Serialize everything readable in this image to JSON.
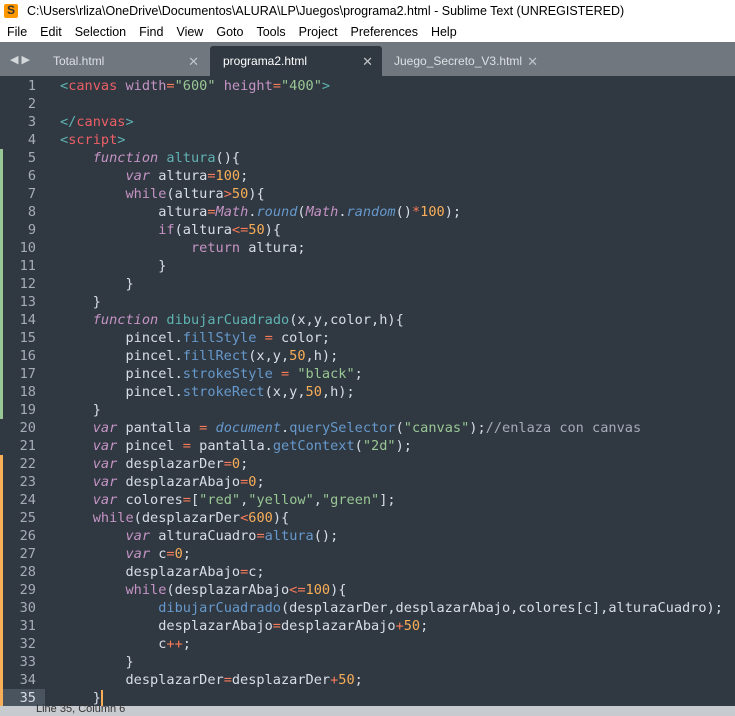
{
  "window": {
    "title": "C:\\Users\\rliza\\OneDrive\\Documentos\\ALURA\\LP\\Juegos\\programa2.html - Sublime Text (UNREGISTERED)"
  },
  "menu": [
    "File",
    "Edit",
    "Selection",
    "Find",
    "View",
    "Goto",
    "Tools",
    "Project",
    "Preferences",
    "Help"
  ],
  "tabs": [
    {
      "label": "Total.html",
      "active": false
    },
    {
      "label": "programa2.html",
      "active": true
    },
    {
      "label": "Juego_Secreto_V3.html",
      "active": false
    }
  ],
  "status": {
    "text": "Line 35, Column 6"
  },
  "colors": {
    "background": "#303841",
    "added": "#99c794",
    "modified": "#f9ae58"
  },
  "current_line": 35,
  "gutter_marks": {
    "added": [
      5,
      19
    ],
    "modified": [
      22,
      35
    ]
  },
  "code": [
    [
      [
        "p",
        "<"
      ],
      [
        "t",
        "canvas"
      ],
      [
        "a",
        " width"
      ],
      [
        "o",
        "="
      ],
      [
        "s",
        "\"600\""
      ],
      [
        "a",
        " height"
      ],
      [
        "o",
        "="
      ],
      [
        "s",
        "\"400\""
      ],
      [
        "p",
        ">"
      ]
    ],
    [],
    [
      [
        "p",
        "</"
      ],
      [
        "t",
        "canvas"
      ],
      [
        "p",
        ">"
      ]
    ],
    [
      [
        "p",
        "<"
      ],
      [
        "t",
        "script"
      ],
      [
        "p",
        ">"
      ]
    ],
    [
      [
        "x",
        "    "
      ],
      [
        "k",
        "function"
      ],
      [
        "x",
        " "
      ],
      [
        "f",
        "altura"
      ],
      [
        "x",
        "(){"
      ]
    ],
    [
      [
        "x",
        "        "
      ],
      [
        "k",
        "var"
      ],
      [
        "x",
        " altura"
      ],
      [
        "o",
        "="
      ],
      [
        "n",
        "100"
      ],
      [
        "x",
        ";"
      ]
    ],
    [
      [
        "x",
        "        "
      ],
      [
        "c",
        "while"
      ],
      [
        "x",
        "(altura"
      ],
      [
        "o",
        ">"
      ],
      [
        "n",
        "50"
      ],
      [
        "x",
        "){"
      ]
    ],
    [
      [
        "x",
        "            altura"
      ],
      [
        "o",
        "="
      ],
      [
        "b",
        "Math"
      ],
      [
        "x",
        "."
      ],
      [
        "mi",
        "round"
      ],
      [
        "x",
        "("
      ],
      [
        "b",
        "Math"
      ],
      [
        "x",
        "."
      ],
      [
        "mi",
        "random"
      ],
      [
        "x",
        "()"
      ],
      [
        "o",
        "*"
      ],
      [
        "n",
        "100"
      ],
      [
        "x",
        ");"
      ]
    ],
    [
      [
        "x",
        "            "
      ],
      [
        "c",
        "if"
      ],
      [
        "x",
        "(altura"
      ],
      [
        "o",
        "<="
      ],
      [
        "n",
        "50"
      ],
      [
        "x",
        "){"
      ]
    ],
    [
      [
        "x",
        "                "
      ],
      [
        "c",
        "return"
      ],
      [
        "x",
        " altura;"
      ]
    ],
    [
      [
        "x",
        "            }"
      ]
    ],
    [
      [
        "x",
        "        }"
      ]
    ],
    [
      [
        "x",
        "    }"
      ]
    ],
    [
      [
        "x",
        "    "
      ],
      [
        "k",
        "function"
      ],
      [
        "x",
        " "
      ],
      [
        "f",
        "dibujarCuadrado"
      ],
      [
        "x",
        "(x,y,color,h){"
      ]
    ],
    [
      [
        "x",
        "        pincel."
      ],
      [
        "m",
        "fillStyle"
      ],
      [
        "x",
        " "
      ],
      [
        "o",
        "="
      ],
      [
        "x",
        " color;"
      ]
    ],
    [
      [
        "x",
        "        pincel."
      ],
      [
        "m",
        "fillRect"
      ],
      [
        "x",
        "(x,y,"
      ],
      [
        "n",
        "50"
      ],
      [
        "x",
        ",h);"
      ]
    ],
    [
      [
        "x",
        "        pincel."
      ],
      [
        "m",
        "strokeStyle"
      ],
      [
        "x",
        " "
      ],
      [
        "o",
        "="
      ],
      [
        "x",
        " "
      ],
      [
        "s",
        "\"black\""
      ],
      [
        "x",
        ";"
      ]
    ],
    [
      [
        "x",
        "        pincel."
      ],
      [
        "m",
        "strokeRect"
      ],
      [
        "x",
        "(x,y,"
      ],
      [
        "n",
        "50"
      ],
      [
        "x",
        ",h);"
      ]
    ],
    [
      [
        "x",
        "    }"
      ]
    ],
    [
      [
        "x",
        "    "
      ],
      [
        "k",
        "var"
      ],
      [
        "x",
        " pantalla "
      ],
      [
        "o",
        "="
      ],
      [
        "x",
        " "
      ],
      [
        "mi",
        "document"
      ],
      [
        "x",
        "."
      ],
      [
        "m",
        "querySelector"
      ],
      [
        "x",
        "("
      ],
      [
        "s",
        "\"canvas\""
      ],
      [
        "x",
        ");"
      ],
      [
        "cm",
        "//enlaza con canvas"
      ]
    ],
    [
      [
        "x",
        "    "
      ],
      [
        "k",
        "var"
      ],
      [
        "x",
        " pincel "
      ],
      [
        "o",
        "="
      ],
      [
        "x",
        " pantalla."
      ],
      [
        "m",
        "getContext"
      ],
      [
        "x",
        "("
      ],
      [
        "s",
        "\"2d\""
      ],
      [
        "x",
        ");"
      ]
    ],
    [
      [
        "x",
        "    "
      ],
      [
        "k",
        "var"
      ],
      [
        "x",
        " desplazarDer"
      ],
      [
        "o",
        "="
      ],
      [
        "n",
        "0"
      ],
      [
        "x",
        ";"
      ]
    ],
    [
      [
        "x",
        "    "
      ],
      [
        "k",
        "var"
      ],
      [
        "x",
        " desplazarAbajo"
      ],
      [
        "o",
        "="
      ],
      [
        "n",
        "0"
      ],
      [
        "x",
        ";"
      ]
    ],
    [
      [
        "x",
        "    "
      ],
      [
        "k",
        "var"
      ],
      [
        "x",
        " colores"
      ],
      [
        "o",
        "="
      ],
      [
        "x",
        "["
      ],
      [
        "s",
        "\"red\""
      ],
      [
        "x",
        ","
      ],
      [
        "s",
        "\"yellow\""
      ],
      [
        "x",
        ","
      ],
      [
        "s",
        "\"green\""
      ],
      [
        "x",
        "];"
      ]
    ],
    [
      [
        "x",
        "    "
      ],
      [
        "c",
        "while"
      ],
      [
        "x",
        "(desplazarDer"
      ],
      [
        "o",
        "<"
      ],
      [
        "n",
        "600"
      ],
      [
        "x",
        "){"
      ]
    ],
    [
      [
        "x",
        "        "
      ],
      [
        "k",
        "var"
      ],
      [
        "x",
        " alturaCuadro"
      ],
      [
        "o",
        "="
      ],
      [
        "m",
        "altura"
      ],
      [
        "x",
        "();"
      ]
    ],
    [
      [
        "x",
        "        "
      ],
      [
        "k",
        "var"
      ],
      [
        "x",
        " c"
      ],
      [
        "o",
        "="
      ],
      [
        "n",
        "0"
      ],
      [
        "x",
        ";"
      ]
    ],
    [
      [
        "x",
        "        desplazarAbajo"
      ],
      [
        "o",
        "="
      ],
      [
        "x",
        "c;"
      ]
    ],
    [
      [
        "x",
        "        "
      ],
      [
        "c",
        "while"
      ],
      [
        "x",
        "(desplazarAbajo"
      ],
      [
        "o",
        "<="
      ],
      [
        "n",
        "100"
      ],
      [
        "x",
        "){"
      ]
    ],
    [
      [
        "x",
        "            "
      ],
      [
        "m",
        "dibujarCuadrado"
      ],
      [
        "x",
        "(desplazarDer,desplazarAbajo,colores[c],alturaCuadro);"
      ]
    ],
    [
      [
        "x",
        "            desplazarAbajo"
      ],
      [
        "o",
        "="
      ],
      [
        "x",
        "desplazarAbajo"
      ],
      [
        "o",
        "+"
      ],
      [
        "n",
        "50"
      ],
      [
        "x",
        ";"
      ]
    ],
    [
      [
        "x",
        "            c"
      ],
      [
        "o",
        "++"
      ],
      [
        "x",
        ";"
      ]
    ],
    [
      [
        "x",
        "        }"
      ]
    ],
    [
      [
        "x",
        "        desplazarDer"
      ],
      [
        "o",
        "="
      ],
      [
        "x",
        "desplazarDer"
      ],
      [
        "o",
        "+"
      ],
      [
        "n",
        "50"
      ],
      [
        "x",
        ";"
      ]
    ],
    [
      [
        "x",
        "    }"
      ]
    ]
  ]
}
